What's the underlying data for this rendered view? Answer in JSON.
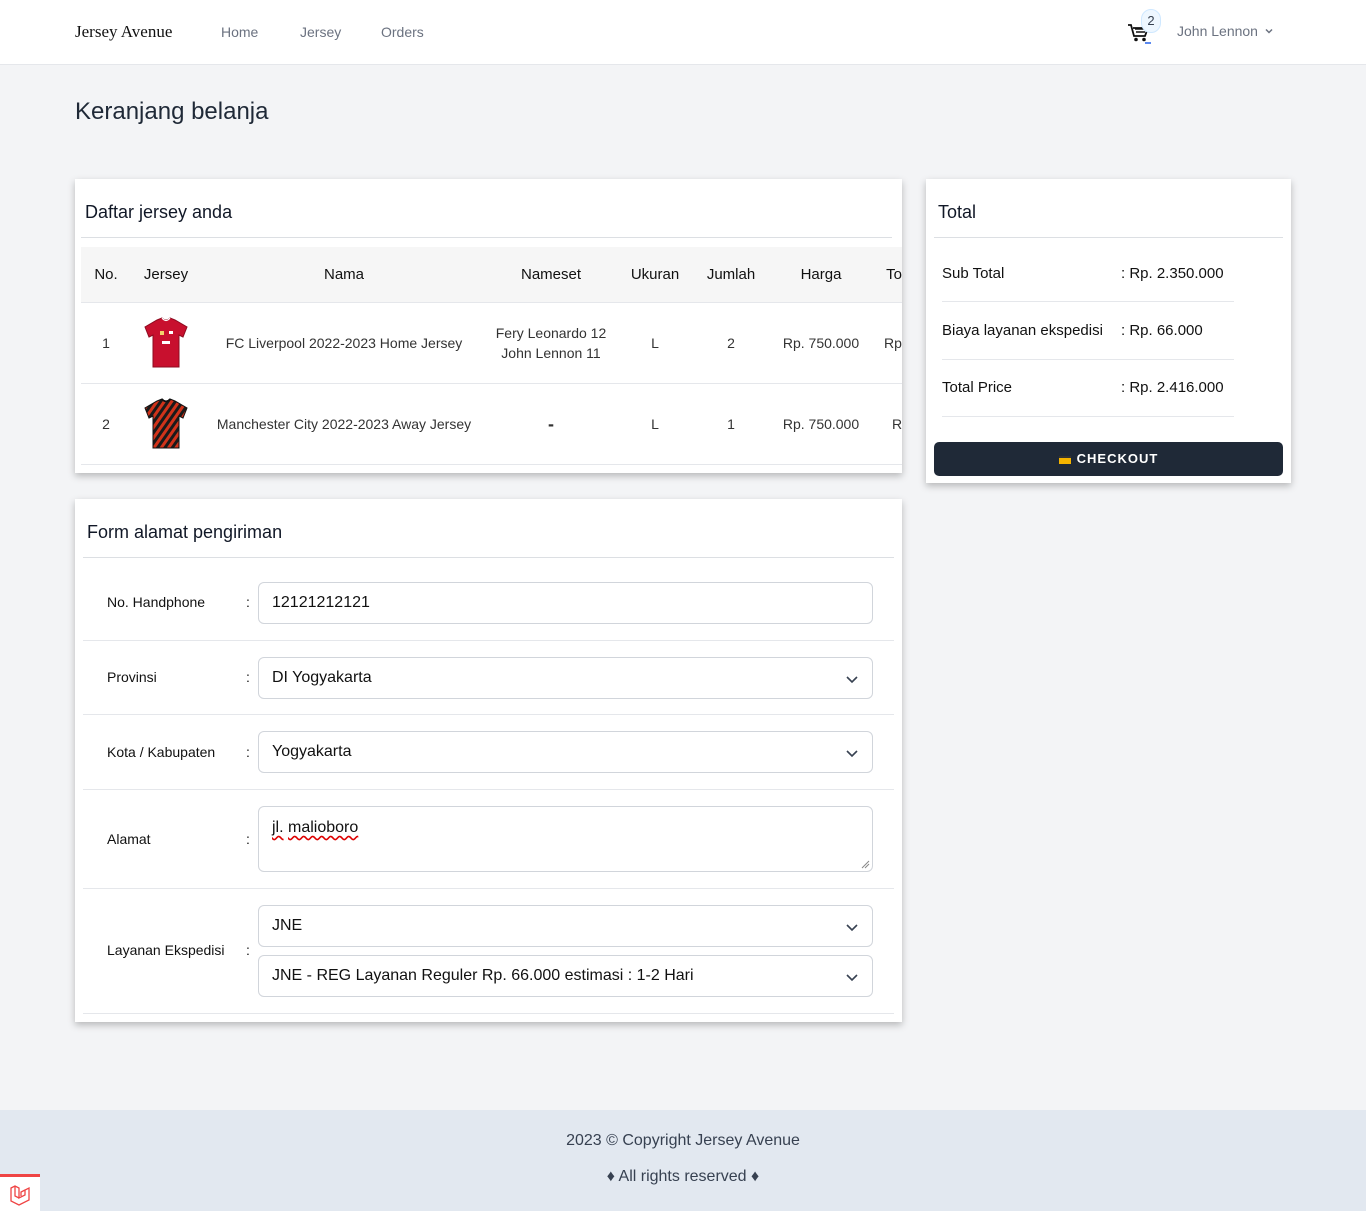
{
  "nav": {
    "brand": "Jersey Avenue",
    "links": [
      "Home",
      "Jersey",
      "Orders"
    ],
    "cart_count": "2",
    "user_name": "John Lennon"
  },
  "page_title": "Keranjang belanja",
  "cart": {
    "title": "Daftar jersey anda",
    "headers": [
      "No.",
      "Jersey",
      "Nama",
      "Nameset",
      "Ukuran",
      "Jumlah",
      "Harga",
      "To"
    ],
    "rows": [
      {
        "no": "1",
        "image": "liverpool-red-jersey",
        "nama": "FC Liverpool 2022-2023 Home Jersey",
        "nameset_1": "Fery Leonardo 12",
        "nameset_2": "John Lennon 11",
        "ukuran": "L",
        "jumlah": "2",
        "harga": "Rp. 750.000",
        "total": "Rp"
      },
      {
        "no": "2",
        "image": "mancity-away-jersey",
        "nama": "Manchester City 2022-2023 Away Jersey",
        "nameset_1": "-",
        "ukuran": "L",
        "jumlah": "1",
        "harga": "Rp. 750.000",
        "total": "Rp"
      }
    ]
  },
  "form": {
    "title": "Form alamat pengiriman",
    "phone_label": "No. Handphone",
    "phone_value": "12121212121",
    "province_label": "Provinsi",
    "province_value": "DI Yogyakarta",
    "city_label": "Kota / Kabupaten",
    "city_value": "Yogyakarta",
    "address_label": "Alamat",
    "address_word1": "jl.",
    "address_word2": "malioboro",
    "courier_label": "Layanan Ekspedisi",
    "courier_value": "JNE",
    "service_value": "JNE - REG Layanan Reguler Rp. 66.000 estimasi : 1-2 Hari",
    "colon": ":"
  },
  "total": {
    "title": "Total",
    "subtotal_label": "Sub Total",
    "subtotal_value": ": Rp. 2.350.000",
    "shipping_label": "Biaya layanan ekspedisi",
    "shipping_value": ": Rp. 66.000",
    "total_label": "Total Price",
    "total_value": ": Rp. 2.416.000",
    "checkout_label": "CHECKOUT"
  },
  "footer": {
    "copyright": "2023 © Copyright Jersey Avenue",
    "rights": "♦ All rights reserved ♦"
  },
  "colors": {
    "accent_dark": "#1f2937",
    "liverpool_red": "#c8102e",
    "city_away": "#d1331a"
  }
}
